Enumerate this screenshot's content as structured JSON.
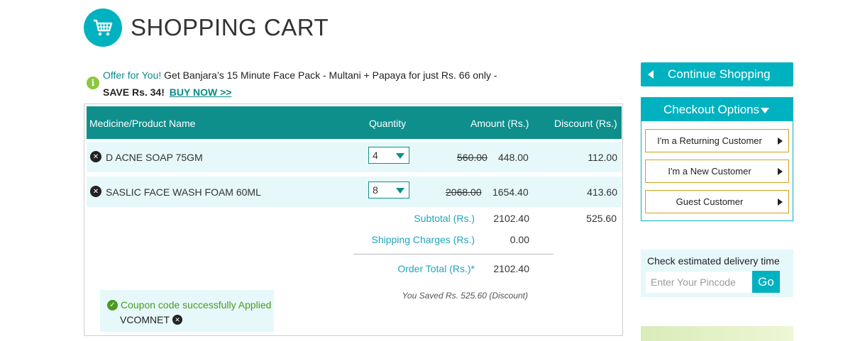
{
  "header": {
    "title": "SHOPPING CART",
    "icon": "shopping-cart-icon"
  },
  "offer": {
    "highlight": "Offer for You!",
    "text": " Get Banjara’s 15 Minute Face Pack - Multani + Papaya for just Rs. 66 only -",
    "save": "SAVE Rs. 34!",
    "link": "BUY NOW >>"
  },
  "table": {
    "headers": {
      "product": "Medicine/Product Name",
      "quantity": "Quantity",
      "amount": "Amount (Rs.)",
      "discount": "Discount (Rs.)"
    },
    "rows": [
      {
        "name": "D ACNE SOAP 75GM",
        "qty": "4",
        "old_price": "560.00",
        "new_price": "448.00",
        "discount": "112.00"
      },
      {
        "name": "SASLIC FACE WASH FOAM 60ML",
        "qty": "8",
        "old_price": "2068.00",
        "new_price": "1654.40",
        "discount": "413.60"
      }
    ]
  },
  "summary": {
    "subtotal_label": "Subtotal (Rs.)",
    "subtotal_value": "2102.40",
    "subtotal_discount": "525.60",
    "shipping_label": "Shipping Charges (Rs.)",
    "shipping_value": "0.00",
    "total_label": "Order Total (Rs.)*",
    "total_value": "2102.40",
    "saved_text": "You Saved Rs. 525.60 (Discount)"
  },
  "coupon": {
    "status": "Coupon code successfully Applied",
    "code": "VCOMNET"
  },
  "sidebar": {
    "continue_label": "Continue Shopping",
    "checkout_title": "Checkout Options",
    "options": [
      "I'm a Returning Customer",
      "I'm a New Customer",
      "Guest Customer"
    ],
    "delivery_title": "Check estimated delivery time",
    "pincode_placeholder": "Enter Your Pincode",
    "go_label": "Go"
  },
  "colors": {
    "accent": "#00b2c0",
    "table_header": "#0e8f8c",
    "row_bg": "#e6f8fa",
    "success": "#4a9a1f"
  }
}
